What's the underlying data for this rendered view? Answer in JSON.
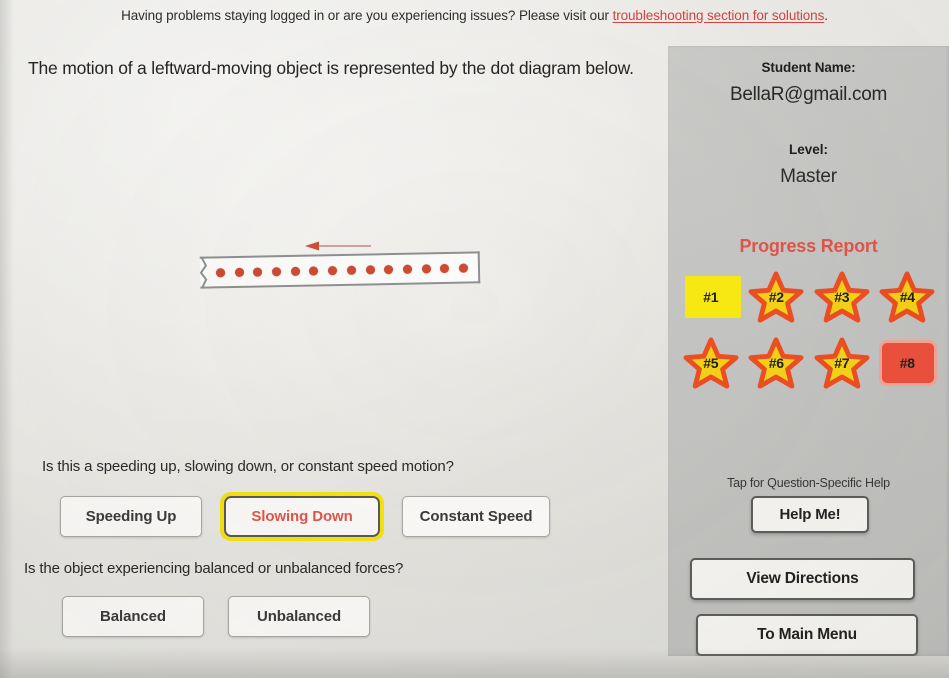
{
  "banner": {
    "text_before": "Having problems staying logged in or are you experiencing issues? Please visit our ",
    "link_text": "troubleshooting section for solutions",
    "text_after": "."
  },
  "main": {
    "prompt": "The motion of a leftward-moving object is represented by the dot diagram below.",
    "diagram": {
      "dot_count": 14,
      "arrow_direction": "left",
      "dot_color": "#cf4a33",
      "spacing": "even"
    },
    "question1": {
      "text": "Is this a speeding up, slowing down, or constant speed motion?",
      "options": [
        {
          "label": "Speeding Up",
          "selected": false
        },
        {
          "label": "Slowing Down",
          "selected": true
        },
        {
          "label": "Constant Speed",
          "selected": false
        }
      ]
    },
    "question2": {
      "text": "Is the object experiencing balanced or unbalanced forces?",
      "options": [
        {
          "label": "Balanced",
          "selected": false
        },
        {
          "label": "Unbalanced",
          "selected": false
        }
      ]
    }
  },
  "sidebar": {
    "student_label": "Student Name:",
    "student_name": "BellaR@gmail.com",
    "level_label": "Level:",
    "level_value": "Master",
    "progress_title": "Progress Report",
    "progress_items": [
      {
        "label": "#1",
        "state": "current"
      },
      {
        "label": "#2",
        "state": "star"
      },
      {
        "label": "#3",
        "state": "star"
      },
      {
        "label": "#4",
        "state": "star"
      },
      {
        "label": "#5",
        "state": "star"
      },
      {
        "label": "#6",
        "state": "star"
      },
      {
        "label": "#7",
        "state": "star"
      },
      {
        "label": "#8",
        "state": "locked"
      }
    ],
    "help_hint": "Tap for Question-Specific Help",
    "help_button": "Help Me!",
    "directions_button": "View Directions",
    "main_menu_button": "To Main Menu"
  },
  "colors": {
    "accent_red": "#e2574a",
    "link_red": "#d6453f",
    "highlight_yellow": "#f5e310",
    "current_yellow": "#f7e713",
    "locked_red": "#e8503c",
    "star_fill": "#f7d417",
    "star_stroke": "#ef4f23",
    "sidebar_bg": "#c6c6c4",
    "page_bg": "#eceae6"
  }
}
